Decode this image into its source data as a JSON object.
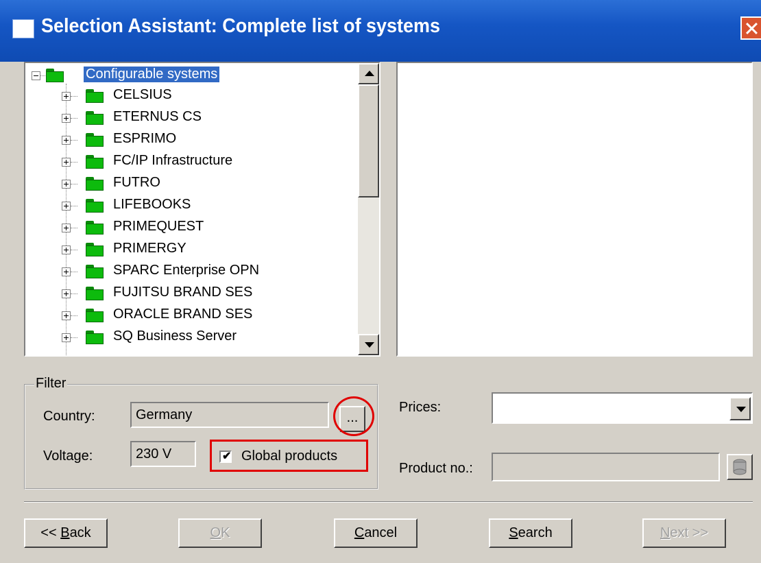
{
  "window": {
    "title": "Selection Assistant: Complete list of systems"
  },
  "tree": {
    "root_label": "Configurable systems",
    "items": [
      "CELSIUS",
      "ETERNUS CS",
      "ESPRIMO",
      "FC/IP Infrastructure",
      "FUTRO",
      "LIFEBOOKS",
      "PRIMEQUEST",
      "PRIMERGY",
      "SPARC Enterprise OPN",
      "FUJITSU BRAND SES",
      "ORACLE BRAND SES",
      "SQ Business Server"
    ]
  },
  "filter": {
    "legend": "Filter",
    "country_label": "Country:",
    "country_value": "Germany",
    "browse_label": "...",
    "voltage_label": "Voltage:",
    "voltage_value": "230 V",
    "global_products_label": "Global products",
    "global_products_checked": true
  },
  "right": {
    "prices_label": "Prices:",
    "prices_value": "",
    "product_no_label": "Product no.:",
    "product_no_value": ""
  },
  "buttons": {
    "back_prefix": "<< ",
    "back_key": "B",
    "back_rest": "ack",
    "ok_key": "O",
    "ok_rest": "K",
    "cancel_key": "C",
    "cancel_rest": "ancel",
    "search_key": "S",
    "search_rest": "earch",
    "next_key": "N",
    "next_rest": "ext >>"
  },
  "colors": {
    "titlebar": "#0f4bb3",
    "selection": "#316ac5",
    "folder": "#0dbb0d",
    "highlight": "#e00000"
  }
}
